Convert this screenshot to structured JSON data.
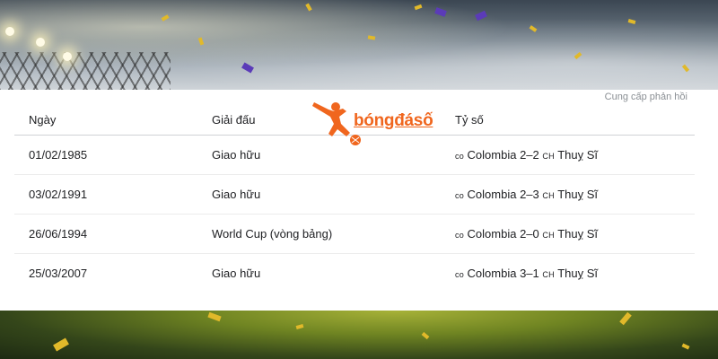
{
  "feedback_label": "Cung cấp phản hồi",
  "logo_text": "bóngđásố",
  "table": {
    "headers": [
      "Ngày",
      "Giải đấu",
      "Tỷ số"
    ],
    "rows": [
      {
        "date": "01/02/1985",
        "competition": "Giao hữu",
        "home_code": "co",
        "home": "Colombia",
        "score": "2–2",
        "away_code": "CH",
        "away": "Thuỵ Sĩ"
      },
      {
        "date": "03/02/1991",
        "competition": "Giao hữu",
        "home_code": "co",
        "home": "Colombia",
        "score": "2–3",
        "away_code": "CH",
        "away": "Thuỵ Sĩ"
      },
      {
        "date": "26/06/1994",
        "competition": "World Cup (vòng bảng)",
        "home_code": "co",
        "home": "Colombia",
        "score": "2–0",
        "away_code": "CH",
        "away": "Thuỵ Sĩ"
      },
      {
        "date": "25/03/2007",
        "competition": "Giao hữu",
        "home_code": "co",
        "home": "Colombia",
        "score": "3–1",
        "away_code": "CH",
        "away": "Thuỵ Sĩ"
      }
    ]
  },
  "colors": {
    "brand": "#f0661e",
    "confetti_gold": "#e1b92a",
    "confetti_purple": "#5b3bb8"
  }
}
